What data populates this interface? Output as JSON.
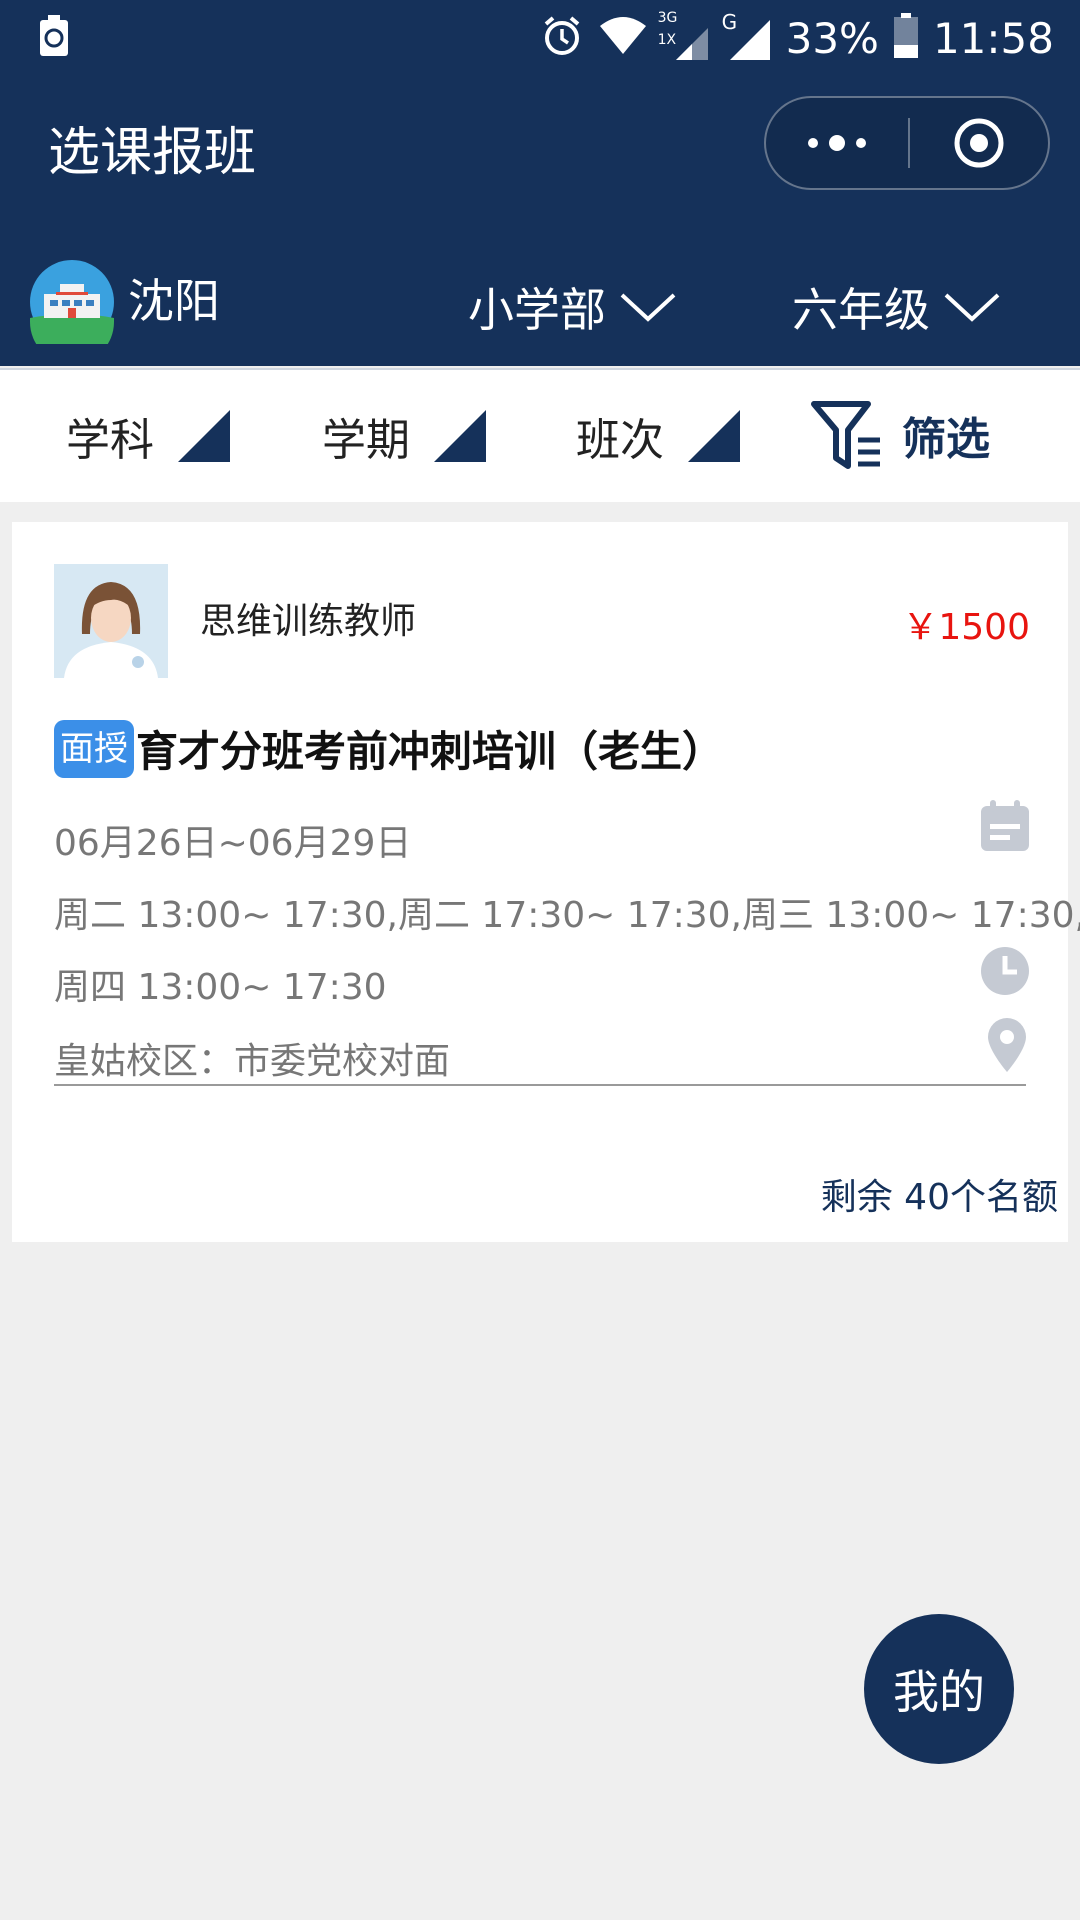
{
  "status_bar": {
    "battery_percent": "33%",
    "time": "11:58",
    "network_3g": "3G",
    "network_1x": "1X",
    "network_g": "G",
    "battery_level": 0.33
  },
  "header": {
    "title": "选课报班",
    "city": "沈阳",
    "department": "小学部",
    "grade": "六年级"
  },
  "filters": {
    "subject": "学科",
    "term": "学期",
    "class_level": "班次",
    "screen": "筛选"
  },
  "course": {
    "teacher": "思维训练教师",
    "price": "￥1500",
    "tag": "面授",
    "title": "育才分班考前冲刺培训（老生）",
    "date_range": "06月26日~06月29日",
    "schedule_line1": "周二 13:00~ 17:30,周二 17:30~ 17:30,周三 13:00~ 17:30,",
    "schedule_line2": "周四 13:00~ 17:30",
    "campus": "皇姑校区：市委党校对面",
    "remaining": "剩余 40个名额"
  },
  "fab": {
    "label": "我的"
  },
  "colors": {
    "primary": "#15315a",
    "price": "#e8140f",
    "tag": "#3b8fe8",
    "background": "#efefef"
  }
}
